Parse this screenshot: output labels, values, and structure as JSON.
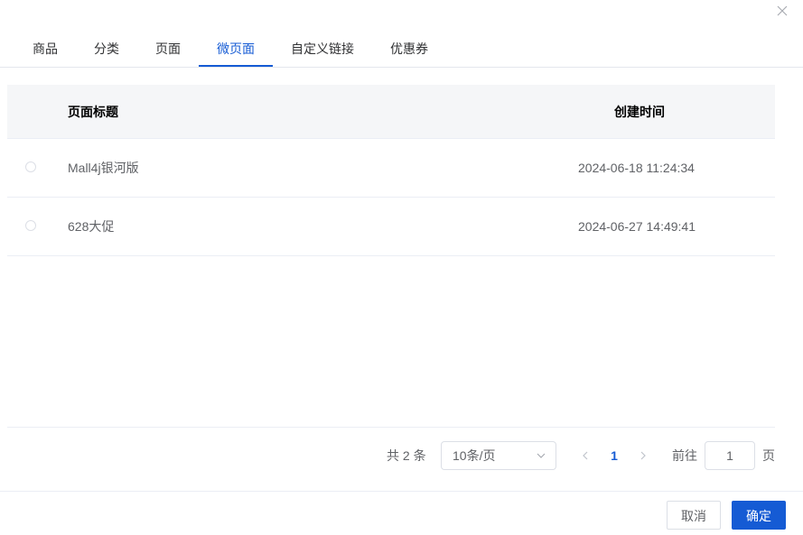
{
  "dialog": {
    "close_icon": "close-icon"
  },
  "tabs": [
    {
      "label": "商品",
      "active": false
    },
    {
      "label": "分类",
      "active": false
    },
    {
      "label": "页面",
      "active": false
    },
    {
      "label": "微页面",
      "active": true
    },
    {
      "label": "自定义链接",
      "active": false
    },
    {
      "label": "优惠券",
      "active": false
    }
  ],
  "table": {
    "columns": {
      "title": "页面标题",
      "created": "创建时间"
    },
    "rows": [
      {
        "title": "Mall4j银河版",
        "created": "2024-06-18 11:24:34",
        "selected": false
      },
      {
        "title": "628大促",
        "created": "2024-06-27 14:49:41",
        "selected": false
      }
    ]
  },
  "pagination": {
    "total": "共 2 条",
    "page_size": "10条/页",
    "current_page": "1",
    "goto_label": "前往",
    "goto_value": "1",
    "goto_suffix": "页"
  },
  "footer": {
    "cancel": "取消",
    "confirm": "确定"
  },
  "colors": {
    "accent": "#155bd4",
    "header_bg": "#f5f6f8",
    "border": "#ebeef5"
  }
}
